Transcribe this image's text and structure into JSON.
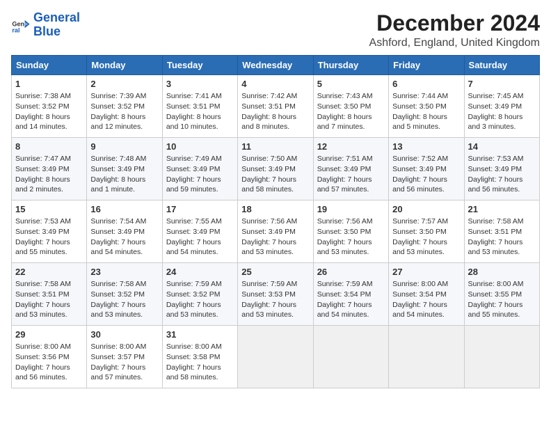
{
  "logo": {
    "line1": "General",
    "line2": "Blue"
  },
  "title": "December 2024",
  "subtitle": "Ashford, England, United Kingdom",
  "columns": [
    "Sunday",
    "Monday",
    "Tuesday",
    "Wednesday",
    "Thursday",
    "Friday",
    "Saturday"
  ],
  "weeks": [
    [
      {
        "day": "1",
        "lines": [
          "Sunrise: 7:38 AM",
          "Sunset: 3:52 PM",
          "Daylight: 8 hours",
          "and 14 minutes."
        ]
      },
      {
        "day": "2",
        "lines": [
          "Sunrise: 7:39 AM",
          "Sunset: 3:52 PM",
          "Daylight: 8 hours",
          "and 12 minutes."
        ]
      },
      {
        "day": "3",
        "lines": [
          "Sunrise: 7:41 AM",
          "Sunset: 3:51 PM",
          "Daylight: 8 hours",
          "and 10 minutes."
        ]
      },
      {
        "day": "4",
        "lines": [
          "Sunrise: 7:42 AM",
          "Sunset: 3:51 PM",
          "Daylight: 8 hours",
          "and 8 minutes."
        ]
      },
      {
        "day": "5",
        "lines": [
          "Sunrise: 7:43 AM",
          "Sunset: 3:50 PM",
          "Daylight: 8 hours",
          "and 7 minutes."
        ]
      },
      {
        "day": "6",
        "lines": [
          "Sunrise: 7:44 AM",
          "Sunset: 3:50 PM",
          "Daylight: 8 hours",
          "and 5 minutes."
        ]
      },
      {
        "day": "7",
        "lines": [
          "Sunrise: 7:45 AM",
          "Sunset: 3:49 PM",
          "Daylight: 8 hours",
          "and 3 minutes."
        ]
      }
    ],
    [
      {
        "day": "8",
        "lines": [
          "Sunrise: 7:47 AM",
          "Sunset: 3:49 PM",
          "Daylight: 8 hours",
          "and 2 minutes."
        ]
      },
      {
        "day": "9",
        "lines": [
          "Sunrise: 7:48 AM",
          "Sunset: 3:49 PM",
          "Daylight: 8 hours",
          "and 1 minute."
        ]
      },
      {
        "day": "10",
        "lines": [
          "Sunrise: 7:49 AM",
          "Sunset: 3:49 PM",
          "Daylight: 7 hours",
          "and 59 minutes."
        ]
      },
      {
        "day": "11",
        "lines": [
          "Sunrise: 7:50 AM",
          "Sunset: 3:49 PM",
          "Daylight: 7 hours",
          "and 58 minutes."
        ]
      },
      {
        "day": "12",
        "lines": [
          "Sunrise: 7:51 AM",
          "Sunset: 3:49 PM",
          "Daylight: 7 hours",
          "and 57 minutes."
        ]
      },
      {
        "day": "13",
        "lines": [
          "Sunrise: 7:52 AM",
          "Sunset: 3:49 PM",
          "Daylight: 7 hours",
          "and 56 minutes."
        ]
      },
      {
        "day": "14",
        "lines": [
          "Sunrise: 7:53 AM",
          "Sunset: 3:49 PM",
          "Daylight: 7 hours",
          "and 56 minutes."
        ]
      }
    ],
    [
      {
        "day": "15",
        "lines": [
          "Sunrise: 7:53 AM",
          "Sunset: 3:49 PM",
          "Daylight: 7 hours",
          "and 55 minutes."
        ]
      },
      {
        "day": "16",
        "lines": [
          "Sunrise: 7:54 AM",
          "Sunset: 3:49 PM",
          "Daylight: 7 hours",
          "and 54 minutes."
        ]
      },
      {
        "day": "17",
        "lines": [
          "Sunrise: 7:55 AM",
          "Sunset: 3:49 PM",
          "Daylight: 7 hours",
          "and 54 minutes."
        ]
      },
      {
        "day": "18",
        "lines": [
          "Sunrise: 7:56 AM",
          "Sunset: 3:49 PM",
          "Daylight: 7 hours",
          "and 53 minutes."
        ]
      },
      {
        "day": "19",
        "lines": [
          "Sunrise: 7:56 AM",
          "Sunset: 3:50 PM",
          "Daylight: 7 hours",
          "and 53 minutes."
        ]
      },
      {
        "day": "20",
        "lines": [
          "Sunrise: 7:57 AM",
          "Sunset: 3:50 PM",
          "Daylight: 7 hours",
          "and 53 minutes."
        ]
      },
      {
        "day": "21",
        "lines": [
          "Sunrise: 7:58 AM",
          "Sunset: 3:51 PM",
          "Daylight: 7 hours",
          "and 53 minutes."
        ]
      }
    ],
    [
      {
        "day": "22",
        "lines": [
          "Sunrise: 7:58 AM",
          "Sunset: 3:51 PM",
          "Daylight: 7 hours",
          "and 53 minutes."
        ]
      },
      {
        "day": "23",
        "lines": [
          "Sunrise: 7:58 AM",
          "Sunset: 3:52 PM",
          "Daylight: 7 hours",
          "and 53 minutes."
        ]
      },
      {
        "day": "24",
        "lines": [
          "Sunrise: 7:59 AM",
          "Sunset: 3:52 PM",
          "Daylight: 7 hours",
          "and 53 minutes."
        ]
      },
      {
        "day": "25",
        "lines": [
          "Sunrise: 7:59 AM",
          "Sunset: 3:53 PM",
          "Daylight: 7 hours",
          "and 53 minutes."
        ]
      },
      {
        "day": "26",
        "lines": [
          "Sunrise: 7:59 AM",
          "Sunset: 3:54 PM",
          "Daylight: 7 hours",
          "and 54 minutes."
        ]
      },
      {
        "day": "27",
        "lines": [
          "Sunrise: 8:00 AM",
          "Sunset: 3:54 PM",
          "Daylight: 7 hours",
          "and 54 minutes."
        ]
      },
      {
        "day": "28",
        "lines": [
          "Sunrise: 8:00 AM",
          "Sunset: 3:55 PM",
          "Daylight: 7 hours",
          "and 55 minutes."
        ]
      }
    ],
    [
      {
        "day": "29",
        "lines": [
          "Sunrise: 8:00 AM",
          "Sunset: 3:56 PM",
          "Daylight: 7 hours",
          "and 56 minutes."
        ]
      },
      {
        "day": "30",
        "lines": [
          "Sunrise: 8:00 AM",
          "Sunset: 3:57 PM",
          "Daylight: 7 hours",
          "and 57 minutes."
        ]
      },
      {
        "day": "31",
        "lines": [
          "Sunrise: 8:00 AM",
          "Sunset: 3:58 PM",
          "Daylight: 7 hours",
          "and 58 minutes."
        ]
      },
      null,
      null,
      null,
      null
    ]
  ]
}
